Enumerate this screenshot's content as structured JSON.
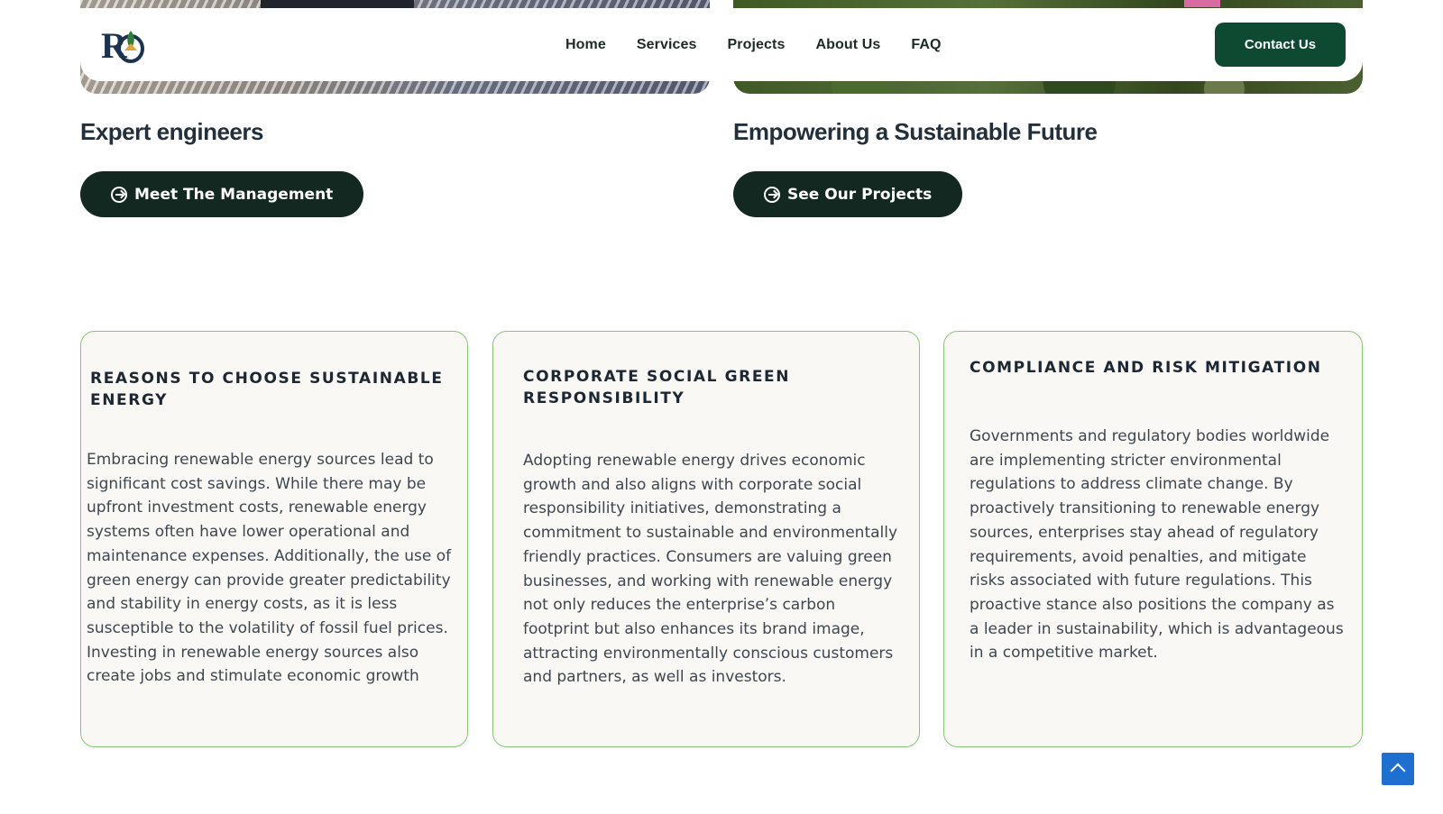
{
  "nav": {
    "links": [
      "Home",
      "Services",
      "Projects",
      "About Us",
      "FAQ"
    ],
    "contact_label": "Contact Us"
  },
  "left_column": {
    "heading": "Expert engineers",
    "button_label": "Meet The Management"
  },
  "right_column": {
    "heading": "Empowering a Sustainable Future",
    "button_label": "See Our Projects"
  },
  "cards": [
    {
      "title": "Reasons to Choose Sustainable Energy",
      "body": "Embracing renewable energy sources lead to significant cost savings. While there may be upfront investment costs, renewable energy systems often have lower operational and maintenance expenses. Additionally, the use of green energy can provide greater predictability and stability in energy costs, as it is less susceptible to the volatility of fossil fuel prices. Investing in renewable energy sources also create jobs and stimulate economic growth"
    },
    {
      "title": "Corporate Social Green Responsibility",
      "body": "Adopting renewable energy drives economic growth and also aligns with corporate social responsibility initiatives, demonstrating a commitment to sustainable and environmentally friendly practices. Consumers are valuing green businesses, and working with renewable energy not only reduces the enterprise’s carbon footprint but also enhances its brand image, attracting environmentally conscious customers and partners, as well as investors."
    },
    {
      "title": "Compliance and Risk Mitigation",
      "body": "Governments and regulatory bodies worldwide are implementing stricter environmental regulations to address climate change. By proactively transitioning to renewable energy sources, enterprises stay ahead of regulatory requirements, avoid penalties, and mitigate risks associated with future regulations. This proactive stance also positions the company as a leader in sustainability, which is advantageous in a competitive market."
    }
  ],
  "colors": {
    "brand_green": "#0e4a32",
    "pill_dark": "#122820",
    "card_border": "#8cc37a",
    "scroll_top": "#1f6fd1"
  }
}
